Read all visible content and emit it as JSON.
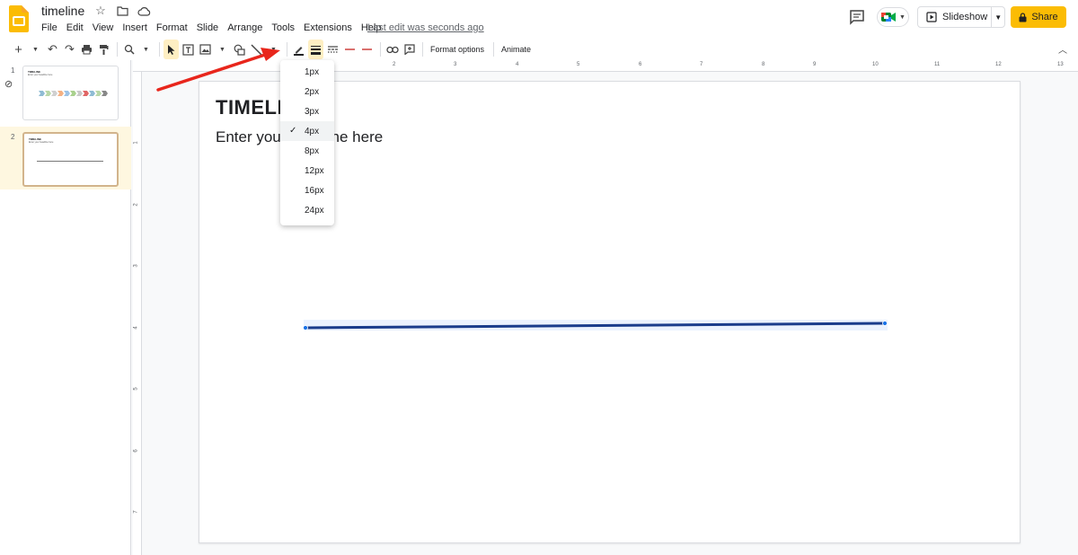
{
  "app": {
    "doc_title": "timeline",
    "last_edit": "Last edit was seconds ago",
    "menu": [
      "File",
      "Edit",
      "View",
      "Insert",
      "Format",
      "Slide",
      "Arrange",
      "Tools",
      "Extensions",
      "Help"
    ],
    "slideshow_label": "Slideshow",
    "share_label": "Share",
    "accent": "#fbbc04"
  },
  "toolbar": {
    "format_options": "Format options",
    "animate": "Animate"
  },
  "slides": {
    "items": [
      {
        "number": "1",
        "title": "TIMELINE",
        "subtitle": "Enter your headline here"
      },
      {
        "number": "2",
        "title": "TIMELINE",
        "subtitle": "Enter your headline here"
      }
    ]
  },
  "rulers": {
    "top": [
      "1",
      "2",
      "3",
      "4",
      "5",
      "6",
      "7",
      "8",
      "9",
      "10",
      "11",
      "12",
      "13"
    ],
    "left": [
      "1",
      "2",
      "3",
      "4",
      "5",
      "6",
      "7"
    ]
  },
  "canvas": {
    "title": "TIMELINE",
    "subtitle": "Enter your headline here",
    "line_color": "#1a3c8b"
  },
  "weight_menu": {
    "options": [
      "1px",
      "2px",
      "3px",
      "4px",
      "8px",
      "12px",
      "16px",
      "24px"
    ],
    "selected": "4px"
  }
}
